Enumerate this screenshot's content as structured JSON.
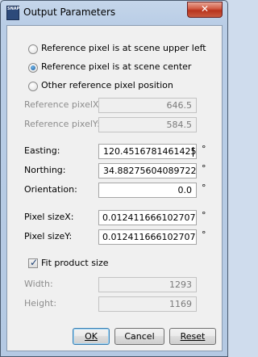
{
  "window": {
    "title": "Output Parameters",
    "close_label": "✕",
    "app_icon_text": "SNAP"
  },
  "radios": [
    {
      "label": "Reference pixel is at scene upper left",
      "checked": false
    },
    {
      "label": "Reference pixel is at scene center",
      "checked": true
    },
    {
      "label": "Other reference pixel position",
      "checked": false
    }
  ],
  "ref_pixel": {
    "x_label": "Reference pixelX:",
    "x_value": "646.5",
    "y_label": "Reference pixelY:",
    "y_value": "584.5"
  },
  "geo": {
    "easting_label": "Easting:",
    "easting_value": "120.45167814614251",
    "northing_label": "Northing:",
    "northing_value": "34.88275604089722",
    "orientation_label": "Orientation:",
    "orientation_value": "0.0",
    "unit": "°"
  },
  "pixel_size": {
    "x_label": "Pixel sizeX:",
    "x_value": "0.012411666102707386",
    "y_label": "Pixel sizeY:",
    "y_value": "0.012411666102707386",
    "unit": "°"
  },
  "fit": {
    "label": "Fit product size",
    "checked": true
  },
  "size": {
    "width_label": "Width:",
    "width_value": "1293",
    "height_label": "Height:",
    "height_value": "1169"
  },
  "buttons": {
    "ok": "OK",
    "cancel": "Cancel",
    "reset": "Reset"
  }
}
